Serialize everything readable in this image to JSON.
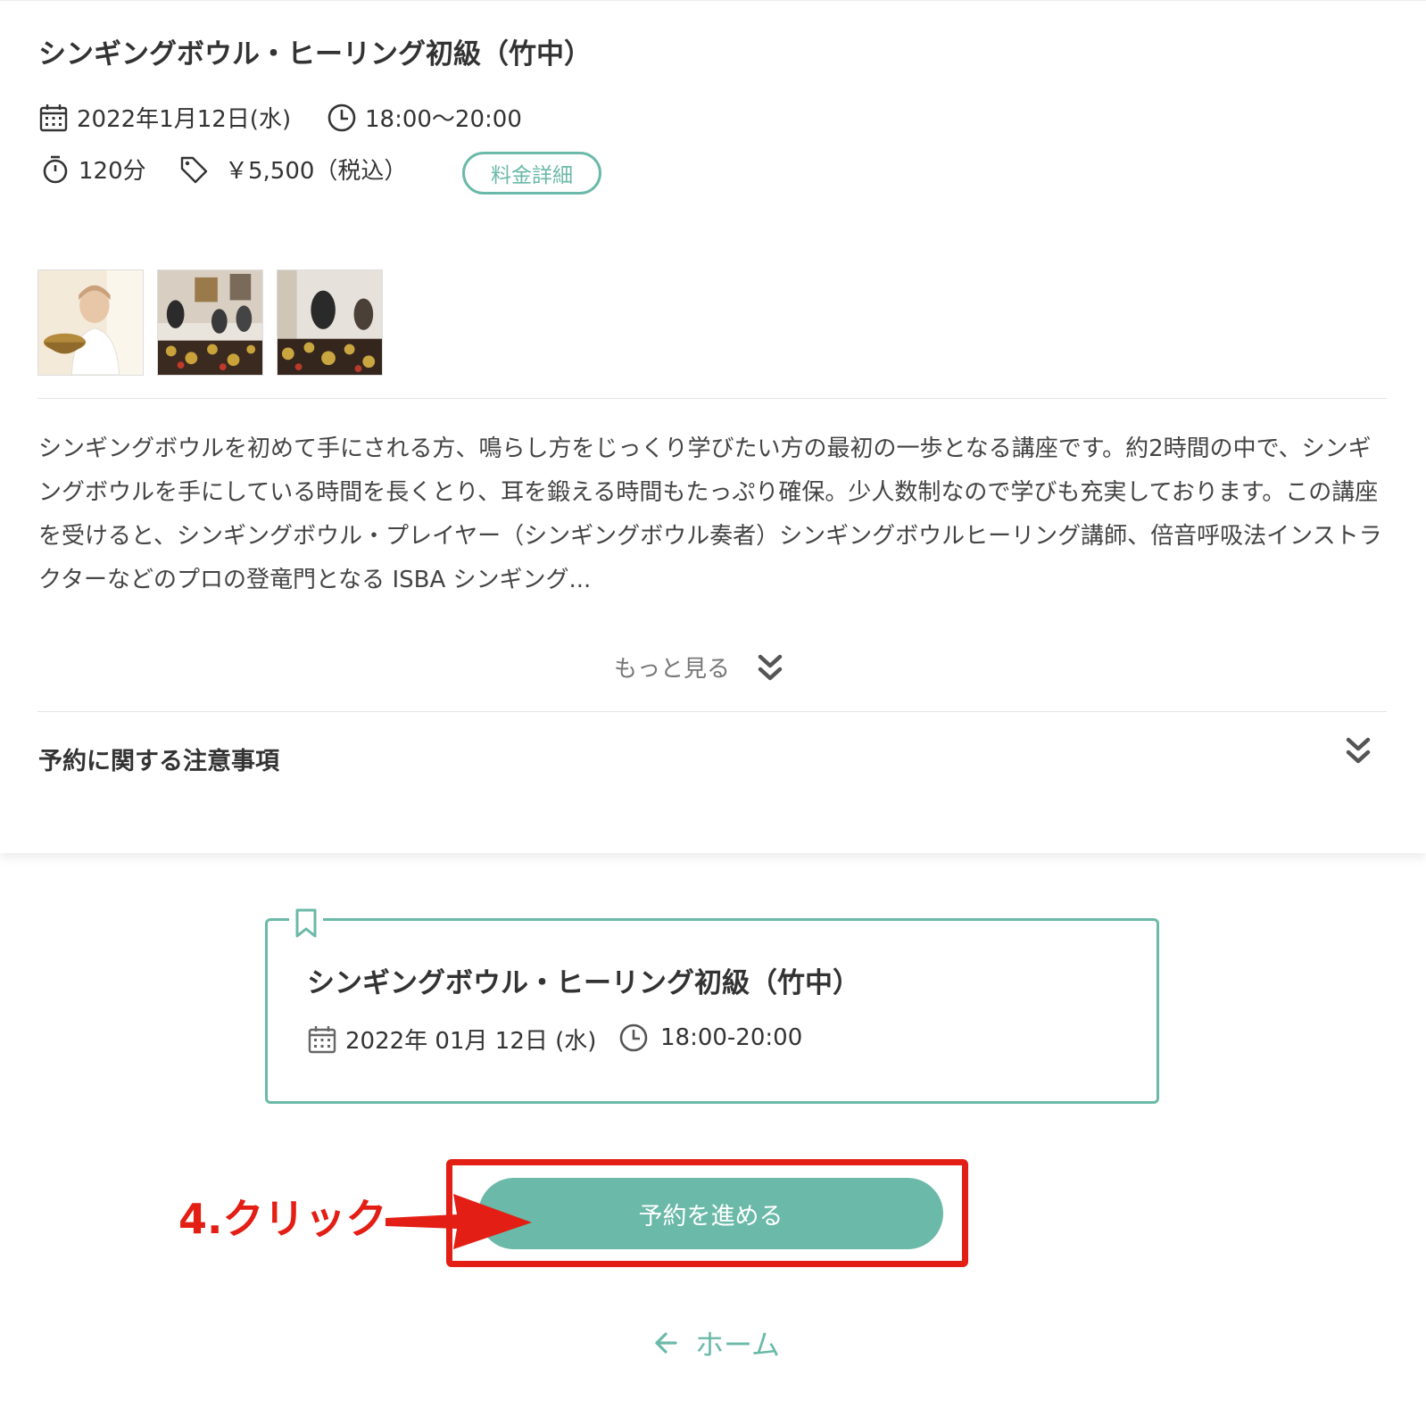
{
  "event": {
    "title": "シンギングボウル・ヒーリング初級（竹中）",
    "date": "2022年1月12日(水)",
    "time": "18:00〜20:00",
    "duration": "120分",
    "price": "￥5,500（税込）",
    "price_detail_label": "料金詳細",
    "description": "シンギングボウルを初めて手にされる方、鳴らし方をじっくり学びたい方の最初の一歩となる講座です。約2時間の中で、シンギングボウルを手にしている時間を長くとり、耳を鍛える時間もたっぷり確保。少人数制なので学びも充実しております。この講座を受けると、シンギングボウル・プレイヤー（シンギングボウル奏者）シンギングボウルヒーリング講師、倍音呼吸法インストラクターなどのプロの登竜門となる ISBA シンギング...",
    "more_label": "もっと見る",
    "notice_title": "予約に関する注意事項"
  },
  "summary": {
    "title": "シンギングボウル・ヒーリング初級（竹中）",
    "date": "2022年 01月 12日 (水)",
    "time": "18:00-20:00"
  },
  "actions": {
    "proceed_label": "予約を進める",
    "home_label": "ホーム"
  },
  "annotation": {
    "label": "4.クリック"
  },
  "colors": {
    "accent": "#6bb9a8",
    "annotation": "#e31e14"
  }
}
